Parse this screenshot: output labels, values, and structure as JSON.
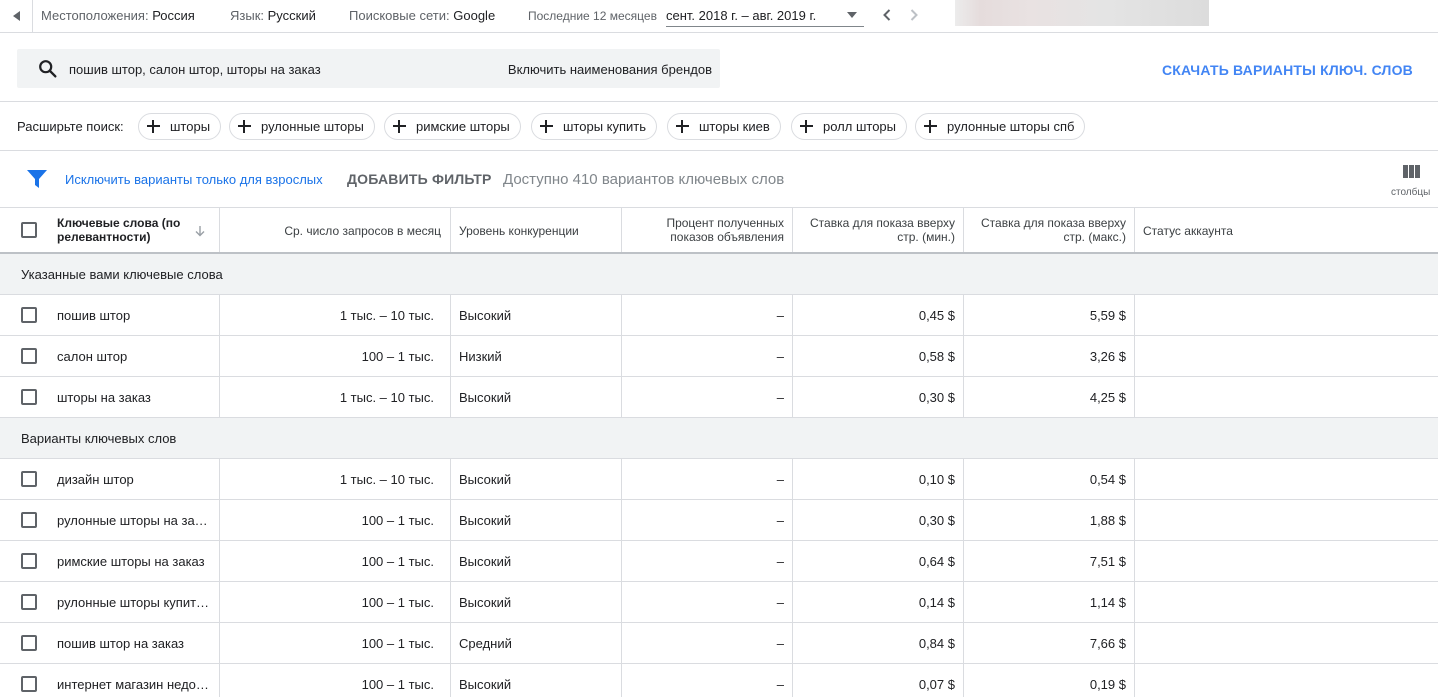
{
  "topbar": {
    "location_label": "Местоположения:",
    "location_value": "Россия",
    "language_label": "Язык:",
    "language_value": "Русский",
    "network_label": "Поисковые сети:",
    "network_value": "Google",
    "period_label": "Последние 12 месяцев",
    "period_value": "сент. 2018 г. – авг. 2019 г."
  },
  "search": {
    "query": "пошив штор, салон штор, шторы на заказ",
    "include_brands": "Включить наименования брендов"
  },
  "download_label": "СКАЧАТЬ ВАРИАНТЫ КЛЮЧ. СЛОВ",
  "expand": {
    "label": "Расширьте поиск:",
    "chips": [
      "шторы",
      "рулонные шторы",
      "римские шторы",
      "шторы купить",
      "шторы киев",
      "ролл шторы",
      "рулонные шторы спб"
    ]
  },
  "filters": {
    "exclude_adult": "Исключить варианты только для взрослых",
    "add_filter": "ДОБАВИТЬ ФИЛЬТР",
    "available": "Доступно 410 вариантов ключевых слов",
    "columns": "столбцы"
  },
  "table": {
    "headers": {
      "keyword_line1": "Ключевые слова (по",
      "keyword_line2": "релевантности)",
      "avg_searches": "Ср. число запросов в месяц",
      "competition": "Уровень конкуренции",
      "impr_share_line1": "Процент полученных",
      "impr_share_line2": "показов объявления",
      "bid_low_line1": "Ставка для показа вверху",
      "bid_low_line2": "стр. (мин.)",
      "bid_high_line1": "Ставка для показа вверху",
      "bid_high_line2": "стр. (макс.)",
      "account_status": "Статус аккаунта"
    },
    "group1": "Указанные вами ключевые слова",
    "rows1": [
      {
        "keyword": "пошив штор",
        "searches": "1 тыс. – 10 тыс.",
        "competition": "Высокий",
        "impr": "–",
        "low": "0,45 $",
        "high": "5,59 $"
      },
      {
        "keyword": "салон штор",
        "searches": "100 – 1 тыс.",
        "competition": "Низкий",
        "impr": "–",
        "low": "0,58 $",
        "high": "3,26 $"
      },
      {
        "keyword": "шторы на заказ",
        "searches": "1 тыс. – 10 тыс.",
        "competition": "Высокий",
        "impr": "–",
        "low": "0,30 $",
        "high": "4,25 $"
      }
    ],
    "group2": "Варианты ключевых слов",
    "rows2": [
      {
        "keyword": "дизайн штор",
        "searches": "1 тыс. – 10 тыс.",
        "competition": "Высокий",
        "impr": "–",
        "low": "0,10 $",
        "high": "0,54 $"
      },
      {
        "keyword": "рулонные шторы на заказ",
        "searches": "100 – 1 тыс.",
        "competition": "Высокий",
        "impr": "–",
        "low": "0,30 $",
        "high": "1,88 $"
      },
      {
        "keyword": "римские шторы на заказ",
        "searches": "100 – 1 тыс.",
        "competition": "Высокий",
        "impr": "–",
        "low": "0,64 $",
        "high": "7,51 $"
      },
      {
        "keyword": "рулонные шторы купить …",
        "searches": "100 – 1 тыс.",
        "competition": "Высокий",
        "impr": "–",
        "low": "0,14 $",
        "high": "1,14 $"
      },
      {
        "keyword": "пошив штор на заказ",
        "searches": "100 – 1 тыс.",
        "competition": "Средний",
        "impr": "–",
        "low": "0,84 $",
        "high": "7,66 $"
      },
      {
        "keyword": "интернет магазин недоро…",
        "searches": "100 – 1 тыс.",
        "competition": "Высокий",
        "impr": "–",
        "low": "0,07 $",
        "high": "0,19 $"
      }
    ]
  },
  "colors": {
    "accent": "#4285f4",
    "link": "#1a73e8",
    "border": "#dadce0",
    "group_bg": "#f1f3f4"
  },
  "icons": {
    "back": "caret-left-icon",
    "prev": "chevron-left-icon",
    "next": "chevron-right-icon",
    "search": "search-icon",
    "chip": "plus-icon",
    "filter": "filter-icon",
    "columns": "columns-icon",
    "sort": "arrow-down-icon"
  }
}
